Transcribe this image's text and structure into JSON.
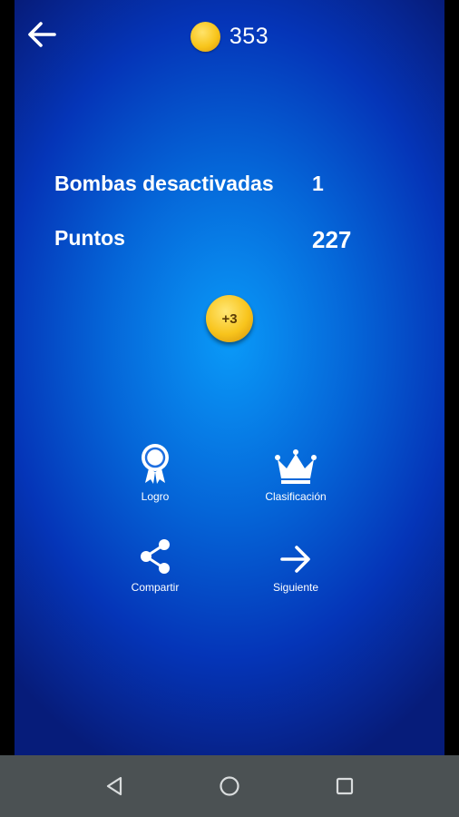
{
  "header": {
    "coins": "353"
  },
  "stats": {
    "bombs_label": "Bombas desactivadas",
    "bombs_value": "1",
    "points_label": "Puntos",
    "points_value": "227"
  },
  "bonus": {
    "label": "+3"
  },
  "actions": {
    "achievement": "Logro",
    "ranking": "Clasificación",
    "share": "Compartir",
    "next": "Siguiente"
  },
  "icons": {
    "back": "arrow-left-icon",
    "coin": "coin-icon",
    "achievement": "ribbon-award-icon",
    "ranking": "crown-icon",
    "share": "share-icon",
    "next": "arrow-right-icon",
    "nav_back": "triangle-back-icon",
    "nav_home": "circle-home-icon",
    "nav_recents": "square-recents-icon"
  },
  "colors": {
    "background_center": "#0a9af8",
    "background_edge": "#061c7a",
    "coin": "#f8c51b",
    "navbar": "#4b5153",
    "text": "#ffffff"
  }
}
